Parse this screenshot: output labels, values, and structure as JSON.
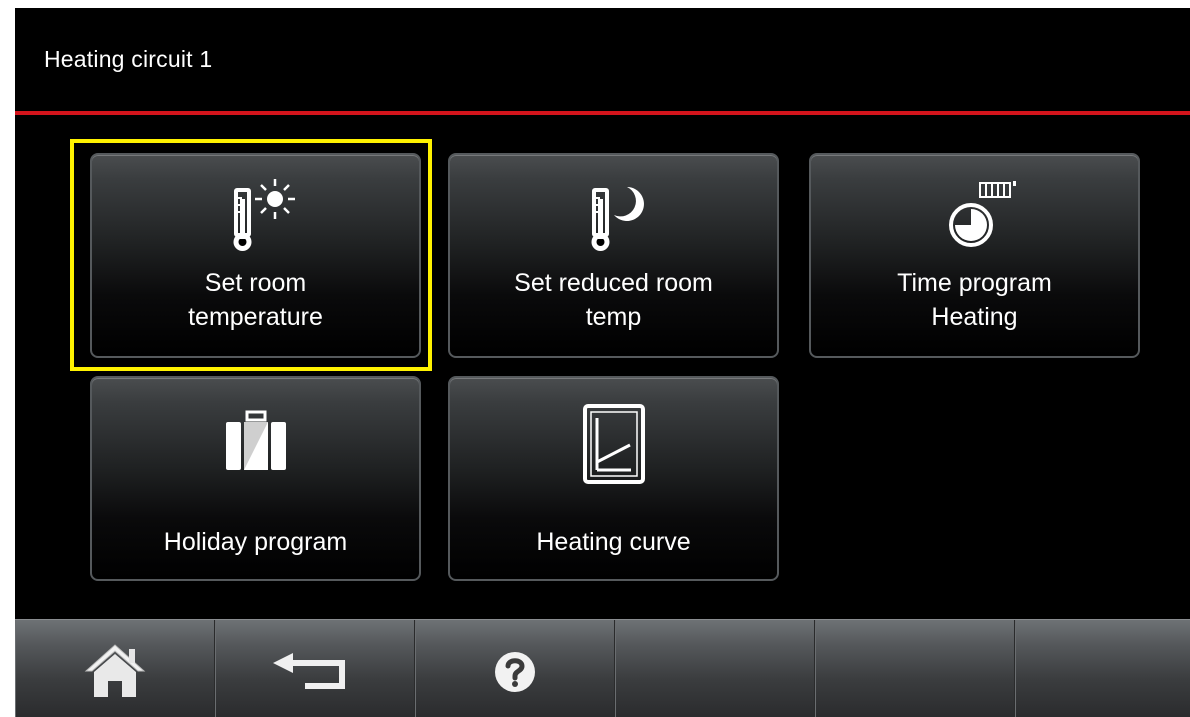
{
  "header": {
    "title": "Heating circuit 1"
  },
  "tiles": [
    {
      "line1": "Set room",
      "line2": "temperature",
      "icon": "thermometer-sun-icon",
      "selected": true
    },
    {
      "line1": "Set reduced room",
      "line2": "temp",
      "icon": "thermometer-moon-icon"
    },
    {
      "line1": "Time program",
      "line2": "Heating",
      "icon": "clock-radiator-icon"
    },
    {
      "line1": "Holiday program",
      "icon": "suitcase-icon"
    },
    {
      "line1": "Heating curve",
      "icon": "heating-curve-icon"
    }
  ],
  "nav": [
    {
      "icon": "home-icon"
    },
    {
      "icon": "back-arrow-icon"
    },
    {
      "icon": "help-icon"
    }
  ],
  "colors": {
    "accent_red": "#d4141c",
    "selection_yellow": "#fff200",
    "background": "#000000"
  }
}
